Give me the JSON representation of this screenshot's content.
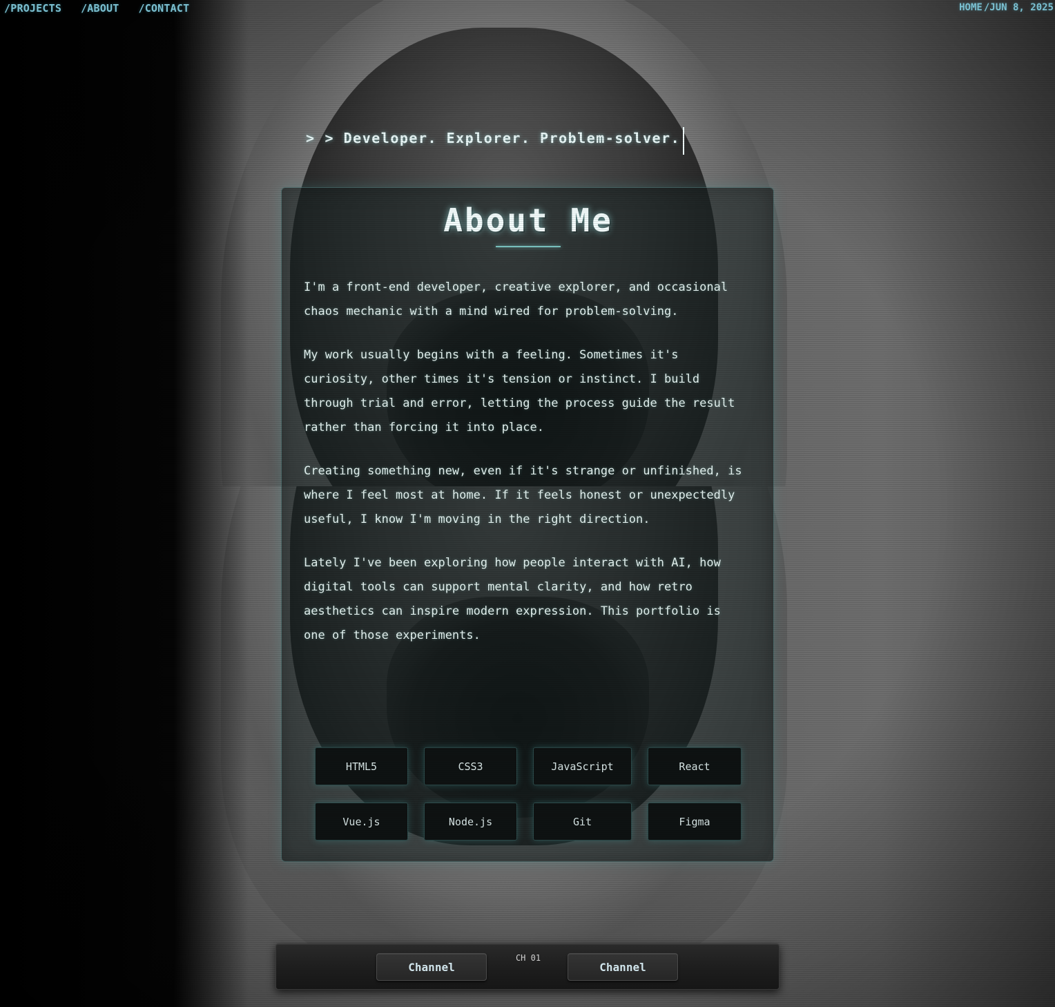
{
  "nav": {
    "items": [
      "/PROJECTS",
      "/ABOUT",
      "/CONTACT"
    ]
  },
  "breadcrumb": {
    "home": "HOME",
    "date": "/JUN 8, 2025"
  },
  "tagline": {
    "prompt": ">",
    "text": "> Developer. Explorer. Problem-solver."
  },
  "about": {
    "title": "About Me",
    "paragraphs": [
      "I'm a front-end developer, creative explorer, and occasional chaos mechanic with a mind wired for problem-solving.",
      "My work usually begins with a feeling. Sometimes it's curiosity, other times it's tension or instinct. I build through trial and error, letting the process guide the result rather than forcing it into place.",
      "Creating something new, even if it's strange or unfinished, is where I feel most at home. If it feels honest or unexpectedly useful, I know I'm moving in the right direction.",
      "Lately I've been exploring how people interact with AI, how digital tools can support mental clarity, and how retro aesthetics can inspire modern expression. This portfolio is one of those experiments."
    ],
    "skills": [
      "HTML5",
      "CSS3",
      "JavaScript",
      "React",
      "Vue.js",
      "Node.js",
      "Git",
      "Figma"
    ]
  },
  "channel_bar": {
    "prev_label": "Channel",
    "next_label": "Channel",
    "channel": "CH 01"
  },
  "colors": {
    "accent": "#7fc6d8",
    "glow": "#7ec9c6",
    "text": "#e6f4f2"
  }
}
